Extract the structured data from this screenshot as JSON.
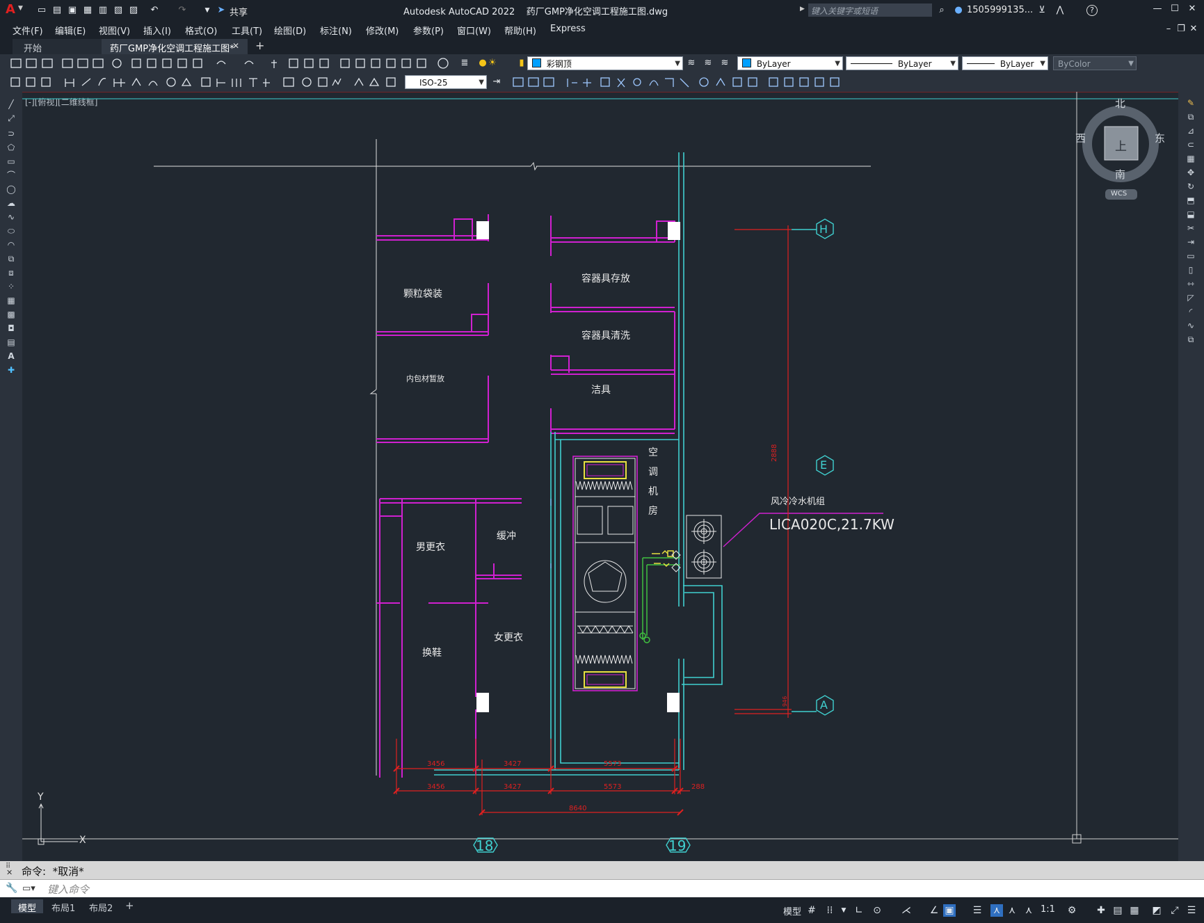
{
  "app": {
    "logo_letter": "A",
    "share_label": "共享",
    "title": "Autodesk AutoCAD 2022    药厂GMP净化空调工程施工图.dwg",
    "search_placeholder": "键入关键字或短语",
    "user": "1505999135...",
    "help": "?"
  },
  "menu": [
    "文件(F)",
    "编辑(E)",
    "视图(V)",
    "插入(I)",
    "格式(O)",
    "工具(T)",
    "绘图(D)",
    "标注(N)",
    "修改(M)",
    "参数(P)",
    "窗口(W)",
    "帮助(H)",
    "Express"
  ],
  "tabs": {
    "start": "开始",
    "active": "药厂GMP净化空调工程施工图*",
    "close": "✕",
    "add": "+"
  },
  "toolbar": {
    "layer_name": "彩钢顶",
    "color": "ByLayer",
    "linetype": "ByLayer",
    "lineweight": "ByLayer",
    "plotstyle": "ByColor",
    "dimstyle": "ISO-25"
  },
  "viewport_label": "[-][俯视][二维线框]",
  "viewcube": {
    "north": "北",
    "south": "南",
    "east": "东",
    "west": "西",
    "face": "上",
    "wcs": "WCS"
  },
  "ucs": {
    "x": "X",
    "y": "Y"
  },
  "drawing": {
    "rooms": [
      "颗粒袋装",
      "容器具存放",
      "容器具清洗",
      "内包材暂放",
      "洁具",
      "男更衣",
      "缓冲",
      "女更衣",
      "换鞋"
    ],
    "ahu_room": [
      "空",
      "调",
      "机",
      "房"
    ],
    "unit_label": "风冷冷水机组",
    "unit_model": "LICA020C,21.7KW",
    "grid_h": "H",
    "grid_e": "E",
    "grid_a": "A",
    "grid_18": "18",
    "grid_19": "19",
    "dims_row1": [
      "3456",
      "3427",
      "5573"
    ],
    "dims_row2": [
      "3456",
      "3427",
      "5573",
      "288"
    ],
    "dims_total": "8640",
    "dim_vert_upper": "2888",
    "dim_vert_lower": "946"
  },
  "command": {
    "history": "命令:  *取消*",
    "placeholder": "键入命令"
  },
  "layout_tabs": [
    "模型",
    "布局1",
    "布局2",
    "+"
  ],
  "status": {
    "model": "模型",
    "scale": "1:1"
  },
  "colors": {
    "wall": "#d020d0",
    "dim": "#e02020",
    "grid": "#40d0d0",
    "text": "#e8e8e8",
    "equipment_yellow": "#e8e040",
    "pipe_green": "#40c040"
  }
}
